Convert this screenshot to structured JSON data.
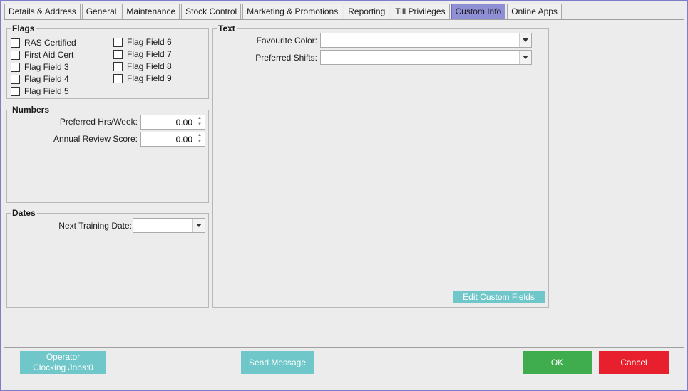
{
  "tabs": [
    {
      "label": "Details & Address",
      "active": false
    },
    {
      "label": "General",
      "active": false
    },
    {
      "label": "Maintenance",
      "active": false
    },
    {
      "label": "Stock Control",
      "active": false
    },
    {
      "label": "Marketing & Promotions",
      "active": false
    },
    {
      "label": "Reporting",
      "active": false
    },
    {
      "label": "Till Privileges",
      "active": false
    },
    {
      "label": "Custom Info",
      "active": true
    },
    {
      "label": "Online Apps",
      "active": false
    }
  ],
  "flags": {
    "title": "Flags",
    "items": [
      {
        "label": "RAS Certified",
        "checked": false
      },
      {
        "label": "First Aid Cert",
        "checked": false
      },
      {
        "label": "Flag Field 3",
        "checked": false
      },
      {
        "label": "Flag Field 4",
        "checked": false
      },
      {
        "label": "Flag Field 5",
        "checked": false
      },
      {
        "label": "Flag Field 6",
        "checked": false
      },
      {
        "label": "Flag Field 7",
        "checked": false
      },
      {
        "label": "Flag Field 8",
        "checked": false
      },
      {
        "label": "Flag Field 9",
        "checked": false
      }
    ]
  },
  "numbers": {
    "title": "Numbers",
    "preferred_hrs_label": "Preferred Hrs/Week:",
    "preferred_hrs_value": "0.00",
    "annual_review_label": "Annual Review Score:",
    "annual_review_value": "0.00"
  },
  "dates": {
    "title": "Dates",
    "next_training_label": "Next Training Date:",
    "next_training_value": ""
  },
  "text": {
    "title": "Text",
    "favourite_color_label": "Favourite Color:",
    "favourite_color_value": "",
    "preferred_shifts_label": "Preferred Shifts:",
    "preferred_shifts_value": "",
    "edit_custom_fields_label": "Edit Custom Fields"
  },
  "footer": {
    "operator_clocking_line1": "Operator",
    "operator_clocking_line2": "Clocking Jobs:0",
    "send_message_label": "Send Message",
    "ok_label": "OK",
    "cancel_label": "Cancel"
  },
  "colors": {
    "active_tab": "#8f8fd6",
    "teal_button": "#6fc7c9",
    "ok_button": "#3fad4e",
    "cancel_button": "#e8202d",
    "window_border": "#7f7ccc"
  }
}
